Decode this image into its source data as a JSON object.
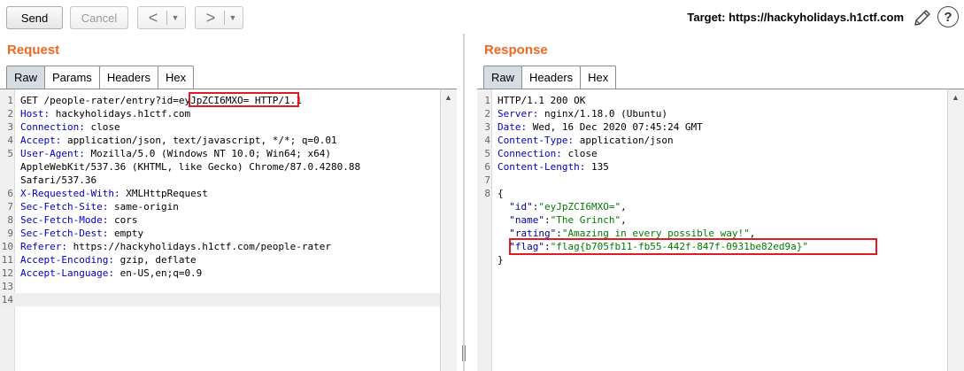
{
  "toolbar": {
    "send_label": "Send",
    "cancel_label": "Cancel",
    "back_arrow": "<",
    "forward_arrow": ">",
    "dropdown_glyph": "▼",
    "target_label": "Target: https://hackyholidays.h1ctf.com",
    "help_glyph": "?"
  },
  "request": {
    "title": "Request",
    "tabs": [
      "Raw",
      "Params",
      "Headers",
      "Hex"
    ],
    "active_tab": "Raw",
    "lines": [
      {
        "n": "1",
        "parts": [
          [
            "GET /people-rater/entry?",
            ""
          ],
          [
            "id=eyJpZCI6MXO=",
            "hl"
          ],
          [
            " HTTP/1.1",
            ""
          ]
        ]
      },
      {
        "n": "2",
        "parts": [
          [
            "Host:",
            "k"
          ],
          [
            " hackyholidays.h1ctf.com",
            ""
          ]
        ]
      },
      {
        "n": "3",
        "parts": [
          [
            "Connection:",
            "k"
          ],
          [
            " close",
            ""
          ]
        ]
      },
      {
        "n": "4",
        "parts": [
          [
            "Accept:",
            "k"
          ],
          [
            " application/json, text/javascript, */*; q=0.01",
            ""
          ]
        ]
      },
      {
        "n": "5",
        "parts": [
          [
            "User-Agent:",
            "k"
          ],
          [
            " Mozilla/5.0 (Windows NT 10.0; Win64; x64)",
            ""
          ]
        ]
      },
      {
        "n": "",
        "parts": [
          [
            "AppleWebKit/537.36 (KHTML, like Gecko) Chrome/87.0.4280.88",
            ""
          ]
        ]
      },
      {
        "n": "",
        "parts": [
          [
            "Safari/537.36",
            ""
          ]
        ]
      },
      {
        "n": "6",
        "parts": [
          [
            "X-Requested-With:",
            "k"
          ],
          [
            " XMLHttpRequest",
            ""
          ]
        ]
      },
      {
        "n": "7",
        "parts": [
          [
            "Sec-Fetch-Site:",
            "k"
          ],
          [
            " same-origin",
            ""
          ]
        ]
      },
      {
        "n": "8",
        "parts": [
          [
            "Sec-Fetch-Mode:",
            "k"
          ],
          [
            " cors",
            ""
          ]
        ]
      },
      {
        "n": "9",
        "parts": [
          [
            "Sec-Fetch-Dest:",
            "k"
          ],
          [
            " empty",
            ""
          ]
        ]
      },
      {
        "n": "10",
        "parts": [
          [
            "Referer:",
            "k"
          ],
          [
            " https://hackyholidays.h1ctf.com/people-rater",
            ""
          ]
        ]
      },
      {
        "n": "11",
        "parts": [
          [
            "Accept-Encoding:",
            "k"
          ],
          [
            " gzip, deflate",
            ""
          ]
        ]
      },
      {
        "n": "12",
        "parts": [
          [
            "Accept-Language:",
            "k"
          ],
          [
            " en-US,en;q=0.9",
            ""
          ]
        ]
      },
      {
        "n": "13",
        "parts": []
      },
      {
        "n": "14",
        "parts": []
      }
    ]
  },
  "response": {
    "title": "Response",
    "tabs": [
      "Raw",
      "Headers",
      "Hex"
    ],
    "active_tab": "Raw",
    "lines": [
      {
        "n": "1",
        "parts": [
          [
            "HTTP/1.1 200 OK",
            ""
          ]
        ]
      },
      {
        "n": "2",
        "parts": [
          [
            "Server:",
            "k"
          ],
          [
            " nginx/1.18.0 (Ubuntu)",
            ""
          ]
        ]
      },
      {
        "n": "3",
        "parts": [
          [
            "Date:",
            "k"
          ],
          [
            " Wed, 16 Dec 2020 07:45:24 GMT",
            ""
          ]
        ]
      },
      {
        "n": "4",
        "parts": [
          [
            "Content-Type:",
            "k"
          ],
          [
            " application/json",
            ""
          ]
        ]
      },
      {
        "n": "5",
        "parts": [
          [
            "Connection:",
            "k"
          ],
          [
            " close",
            ""
          ]
        ]
      },
      {
        "n": "6",
        "parts": [
          [
            "Content-Length:",
            "k"
          ],
          [
            " 135",
            ""
          ]
        ]
      },
      {
        "n": "7",
        "parts": []
      },
      {
        "n": "8",
        "parts": [
          [
            "{",
            ""
          ]
        ]
      },
      {
        "n": "",
        "parts": [
          [
            "  ",
            ""
          ],
          [
            "\"id\"",
            "jk"
          ],
          [
            ":",
            ""
          ],
          [
            "\"eyJpZCI6MXO=\"",
            "jv"
          ],
          [
            ",",
            ""
          ]
        ]
      },
      {
        "n": "",
        "parts": [
          [
            "  ",
            ""
          ],
          [
            "\"name\"",
            "jk"
          ],
          [
            ":",
            ""
          ],
          [
            "\"The Grinch\"",
            "jv"
          ],
          [
            ",",
            ""
          ]
        ]
      },
      {
        "n": "",
        "parts": [
          [
            "  ",
            ""
          ],
          [
            "\"rating\"",
            "jk"
          ],
          [
            ":",
            ""
          ],
          [
            "\"Amazing in every possible way!\"",
            "jv"
          ],
          [
            ",",
            ""
          ]
        ]
      },
      {
        "n": "",
        "parts": [
          [
            "  ",
            ""
          ],
          [
            "\"flag\"",
            "jk"
          ],
          [
            ":",
            ""
          ],
          [
            "\"flag{b705fb11-fb55-442f-847f-0931be82ed9a}\"",
            "jv"
          ]
        ]
      },
      {
        "n": "",
        "parts": [
          [
            "}",
            ""
          ]
        ]
      }
    ]
  },
  "colors": {
    "accent": "#f26722",
    "header_key": "#0000c0",
    "json_key": "#000099",
    "json_value": "#007a00",
    "highlight_box": "#e21b23",
    "active_tab": "#d6dce3"
  },
  "icons": {
    "edit": "pencil-icon",
    "help": "help-icon"
  }
}
